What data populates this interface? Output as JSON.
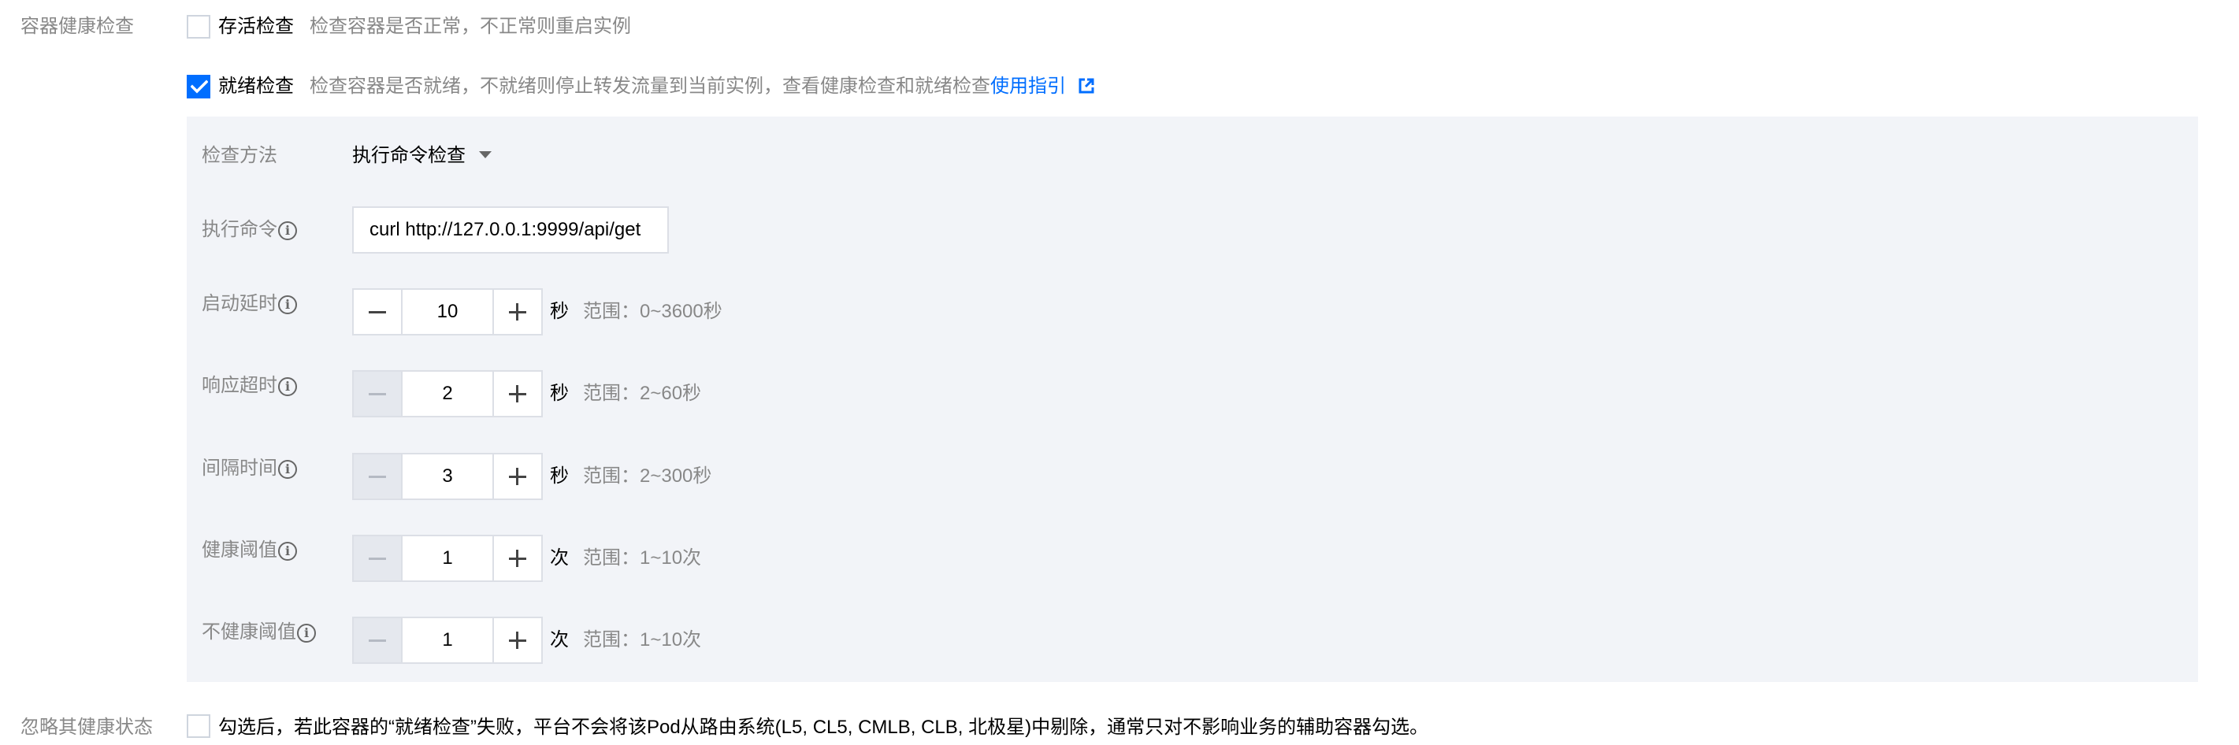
{
  "health_check": {
    "section_label": "容器健康检查",
    "liveness": {
      "label": "存活检查",
      "hint": "检查容器是否正常，不正常则重启实例",
      "checked": false
    },
    "readiness": {
      "label": "就绪检查",
      "hint": "检查容器是否就绪，不就绪则停止转发流量到当前实例，查看健康检查和就绪检查",
      "link_text": "使用指引",
      "checked": true
    },
    "method": {
      "label": "检查方法",
      "value": "执行命令检查"
    },
    "command": {
      "label": "执行命令",
      "value": "curl http://127.0.0.1:9999/api/get"
    },
    "fields": [
      {
        "label": "启动延时",
        "value": "10",
        "unit": "秒",
        "range": "范围：0~3600秒",
        "minus_disabled": false
      },
      {
        "label": "响应超时",
        "value": "2",
        "unit": "秒",
        "range": "范围：2~60秒",
        "minus_disabled": true
      },
      {
        "label": "间隔时间",
        "value": "3",
        "unit": "秒",
        "range": "范围：2~300秒",
        "minus_disabled": true
      },
      {
        "label": "健康阈值",
        "value": "1",
        "unit": "次",
        "range": "范围：1~10次",
        "minus_disabled": true
      },
      {
        "label": "不健康阈值",
        "value": "1",
        "unit": "次",
        "range": "范围：1~10次",
        "minus_disabled": true
      }
    ]
  },
  "ignore_health": {
    "label": "忽略其健康状态",
    "description": "勾选后，若此容器的“就绪检查”失败，平台不会将该Pod从路由系统(L5, CL5, CMLB, CLB, 北极星)中剔除，通常只对不影响业务的辅助容器勾选。",
    "checked": false
  },
  "icons": {
    "info": "info-circle-icon",
    "external_link": "external-link-icon",
    "dropdown": "caret-down-icon",
    "check": "check-icon"
  },
  "colors": {
    "accent": "#006eff",
    "panel_bg": "#f2f4f8",
    "muted_text": "#888888",
    "border": "#dcdfe6"
  }
}
